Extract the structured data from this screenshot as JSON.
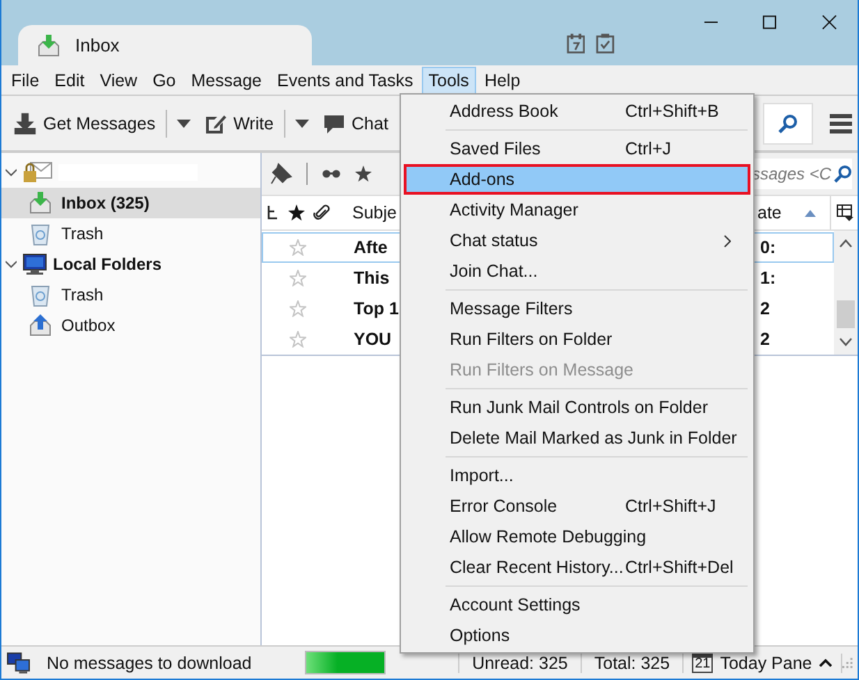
{
  "tab": {
    "title": "Inbox"
  },
  "menubar": [
    {
      "label": "File",
      "selected": false
    },
    {
      "label": "Edit",
      "selected": false
    },
    {
      "label": "View",
      "selected": false
    },
    {
      "label": "Go",
      "selected": false
    },
    {
      "label": "Message",
      "selected": false
    },
    {
      "label": "Events and Tasks",
      "selected": false
    },
    {
      "label": "Tools",
      "selected": true
    },
    {
      "label": "Help",
      "selected": false
    }
  ],
  "toolbar": [
    {
      "kind": "get",
      "label": "Get Messages",
      "dropdown": true
    },
    {
      "kind": "write",
      "label": "Write",
      "dropdown": true
    },
    {
      "kind": "chat",
      "label": "Chat",
      "dropdown": false
    }
  ],
  "folders": [
    {
      "kind": "account",
      "expanded": true,
      "selected": false,
      "children": [
        {
          "kind": "inbox",
          "label": "Inbox (325)",
          "selected": true,
          "bold": true
        },
        {
          "kind": "trash",
          "label": "Trash",
          "selected": false,
          "bold": false
        }
      ]
    },
    {
      "kind": "local",
      "label": "Local Folders",
      "expanded": true,
      "selected": false,
      "children": [
        {
          "kind": "trash",
          "label": "Trash",
          "selected": false,
          "bold": false
        },
        {
          "kind": "outbox",
          "label": "Outbox",
          "selected": false,
          "bold": false
        }
      ]
    }
  ],
  "quick_filter": {
    "search_text": "ssages <C"
  },
  "columns": {
    "subject": "Subje",
    "date": "ate"
  },
  "messages": [
    {
      "subject": "Afte",
      "date": "0:",
      "unread": true,
      "selected": true
    },
    {
      "subject": "This",
      "date": "1:",
      "unread": true,
      "selected": false
    },
    {
      "subject": "Top 1",
      "date": "2",
      "unread": true,
      "selected": false
    },
    {
      "subject": "YOU",
      "date": "2",
      "unread": true,
      "selected": false
    }
  ],
  "tools_menu": [
    {
      "kind": "item",
      "label": "Address Book",
      "shortcut": "Ctrl+Shift+B",
      "selected": false,
      "disabled": false,
      "submenu": false
    },
    {
      "kind": "separator"
    },
    {
      "kind": "item",
      "label": "Saved Files",
      "shortcut": "Ctrl+J",
      "selected": false,
      "disabled": false,
      "submenu": false
    },
    {
      "kind": "item",
      "label": "Add-ons",
      "selected": true,
      "disabled": false,
      "submenu": false
    },
    {
      "kind": "item",
      "label": "Activity Manager",
      "selected": false,
      "disabled": false,
      "submenu": false
    },
    {
      "kind": "item",
      "label": "Chat status",
      "selected": false,
      "disabled": false,
      "submenu": true
    },
    {
      "kind": "item",
      "label": "Join Chat...",
      "selected": false,
      "disabled": false,
      "submenu": false
    },
    {
      "kind": "separator"
    },
    {
      "kind": "item",
      "label": "Message Filters",
      "selected": false,
      "disabled": false,
      "submenu": false
    },
    {
      "kind": "item",
      "label": "Run Filters on Folder",
      "selected": false,
      "disabled": false,
      "submenu": false
    },
    {
      "kind": "item",
      "label": "Run Filters on Message",
      "selected": false,
      "disabled": true,
      "submenu": false
    },
    {
      "kind": "separator"
    },
    {
      "kind": "item",
      "label": "Run Junk Mail Controls on Folder",
      "selected": false,
      "disabled": false,
      "submenu": false
    },
    {
      "kind": "item",
      "label": "Delete Mail Marked as Junk in Folder",
      "selected": false,
      "disabled": false,
      "submenu": false
    },
    {
      "kind": "separator"
    },
    {
      "kind": "item",
      "label": "Import...",
      "selected": false,
      "disabled": false,
      "submenu": false
    },
    {
      "kind": "item",
      "label": "Error Console",
      "shortcut": "Ctrl+Shift+J",
      "selected": false,
      "disabled": false,
      "submenu": false
    },
    {
      "kind": "item",
      "label": "Allow Remote Debugging",
      "selected": false,
      "disabled": false,
      "submenu": false
    },
    {
      "kind": "item",
      "label": "Clear Recent History...",
      "shortcut": "Ctrl+Shift+Del",
      "selected": false,
      "disabled": false,
      "submenu": false
    },
    {
      "kind": "separator"
    },
    {
      "kind": "item",
      "label": "Account Settings",
      "selected": false,
      "disabled": false,
      "submenu": false
    },
    {
      "kind": "item",
      "label": "Options",
      "selected": false,
      "disabled": false,
      "submenu": false
    }
  ],
  "status_bar": {
    "message": "No messages to download",
    "progress": {
      "level": 1
    },
    "unread": "Unread: 325",
    "total": "Total: 325",
    "calendar_day": "21",
    "today_pane": "Today Pane"
  }
}
